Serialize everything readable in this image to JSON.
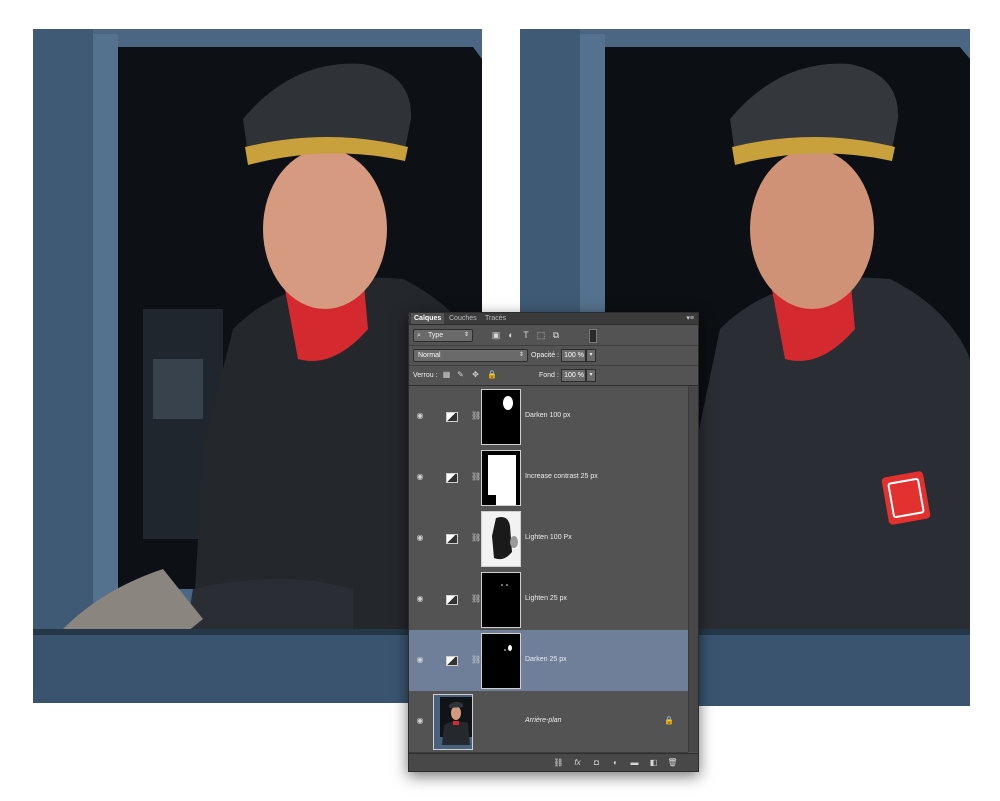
{
  "panel": {
    "tabs": [
      {
        "label": "Calques",
        "active": true
      },
      {
        "label": "Couches",
        "active": false
      },
      {
        "label": "Tracés",
        "active": false
      }
    ],
    "filter": {
      "label": "Type",
      "icons": [
        "image-filter-icon",
        "adjustment-filter-icon",
        "text-filter-icon",
        "shape-filter-icon",
        "smart-object-filter-icon"
      ]
    },
    "blend_mode": "Normal",
    "opacity_label": "Opacité :",
    "opacity_value": "100 %",
    "lock_label": "Verrou :",
    "fill_label": "Fond :",
    "fill_value": "100 %",
    "layers": [
      {
        "name": "Darken 100 px",
        "selected": false
      },
      {
        "name": "Increase contrast 25 px",
        "selected": false
      },
      {
        "name": "Lighten 100 Px",
        "selected": false
      },
      {
        "name": "Lighten 25 px",
        "selected": false
      },
      {
        "name": "Darken 25 px",
        "selected": true
      },
      {
        "name": "Arrière-plan",
        "selected": false,
        "background": true,
        "locked": true
      }
    ],
    "footer_icons": [
      "link-layers-icon",
      "fx-icon",
      "add-mask-icon",
      "adjustment-layer-icon",
      "group-folder-icon",
      "new-layer-icon",
      "trash-icon"
    ]
  },
  "colors": {
    "panel_bg": "#535353",
    "selected_row": "#6f7f99",
    "photo_bg": "#4d6a86"
  }
}
